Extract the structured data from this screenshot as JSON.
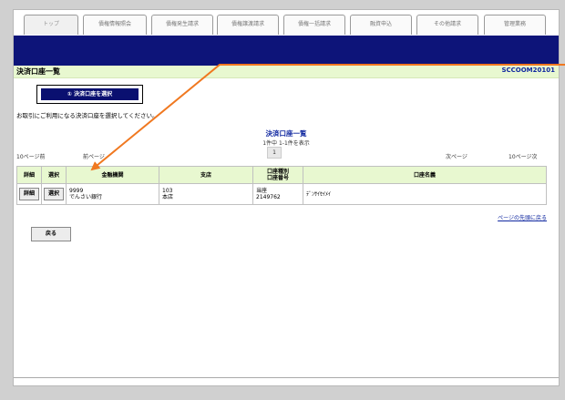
{
  "tabs": [
    "トップ",
    "債権情報照会",
    "債権発生請求",
    "債権譲渡請求",
    "債権一括請求",
    "融資申込",
    "その他請求",
    "管理業務"
  ],
  "page_title": "決済口座一覧",
  "screen_id": "SCCOOM20101",
  "step_button": "① 決済口座を選択",
  "instruction": "お取引にご利用になる決済口座を選択してください。",
  "list_title": "決済口座一覧",
  "list_count": "1件中 1-1件を表示",
  "pager": {
    "prev10": "10ページ前",
    "prev": "前ページ",
    "current_page": "1",
    "next": "次ページ",
    "next10": "10ページ次"
  },
  "table": {
    "headers": {
      "detail": "詳細",
      "select": "選択",
      "bank": "金融機関",
      "branch": "支店",
      "type_line1": "口座種別",
      "type_line2": "口座番号",
      "name": "口座名義"
    },
    "rows": [
      {
        "detail_label": "詳細",
        "select_label": "選択",
        "bank_code": "9999",
        "bank_name": "でんさい銀行",
        "branch_code": "103",
        "branch_name": "本店",
        "account_type": "当座",
        "account_number": "2149762",
        "account_name": "ﾃﾞﾝｻｲｾｲﾒｲ"
      }
    ]
  },
  "page_top_link": "ページの先頭に戻る",
  "back_button": "戻る",
  "colors": {
    "navbar": "#0d1479",
    "title_bar": "#e8f8d0",
    "arrow": "#f07820",
    "link": "#1028a0"
  }
}
